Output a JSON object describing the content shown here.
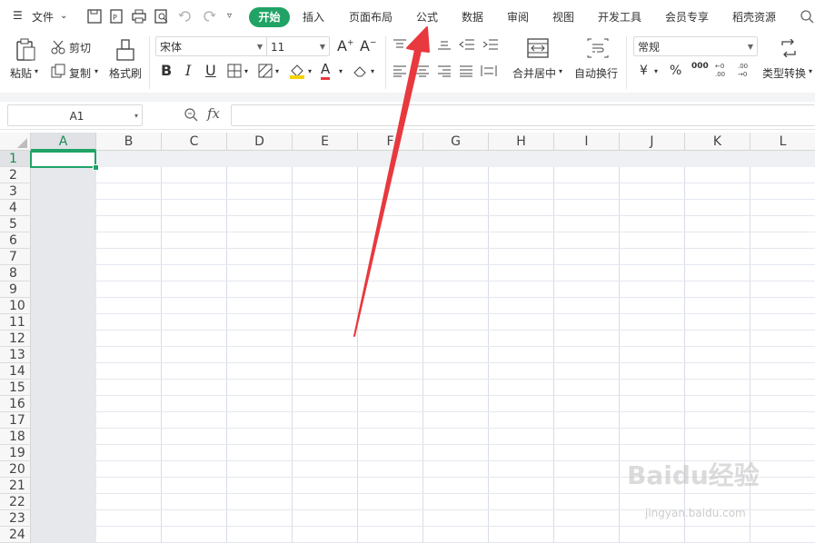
{
  "menubar": {
    "file": "文件",
    "tabs": [
      "开始",
      "插入",
      "页面布局",
      "公式",
      "数据",
      "审阅",
      "视图",
      "开发工具",
      "会员专享",
      "稻壳资源"
    ]
  },
  "toolbar": {
    "paste": "粘贴",
    "cut": "剪切",
    "copy": "复制",
    "format_painter": "格式刷",
    "font_name": "宋体",
    "font_size": "11",
    "merge_center": "合并居中",
    "wrap_text": "自动换行",
    "number_format": "常规",
    "type_convert": "类型转换",
    "currency_symbol": "¥",
    "percent_symbol": "%",
    "thousands_symbol": "000"
  },
  "formula_bar": {
    "cell_ref": "A1",
    "fx": "fx",
    "content": ""
  },
  "sheet": {
    "columns": [
      "A",
      "B",
      "C",
      "D",
      "E",
      "F",
      "G",
      "H",
      "I",
      "J",
      "K",
      "L"
    ],
    "rows": [
      "1",
      "2",
      "3",
      "4",
      "5",
      "6",
      "7",
      "8",
      "9",
      "10",
      "11",
      "12",
      "13",
      "14",
      "15",
      "16",
      "17",
      "18",
      "19",
      "20",
      "21",
      "22",
      "23",
      "24"
    ],
    "selected_cell": "A1"
  },
  "watermark": {
    "brand": "Baidu经验",
    "url": "jingyan.baidu.com"
  },
  "colors": {
    "accent": "#21a366",
    "arrow": "#e8393e",
    "selection": "#21a366"
  }
}
